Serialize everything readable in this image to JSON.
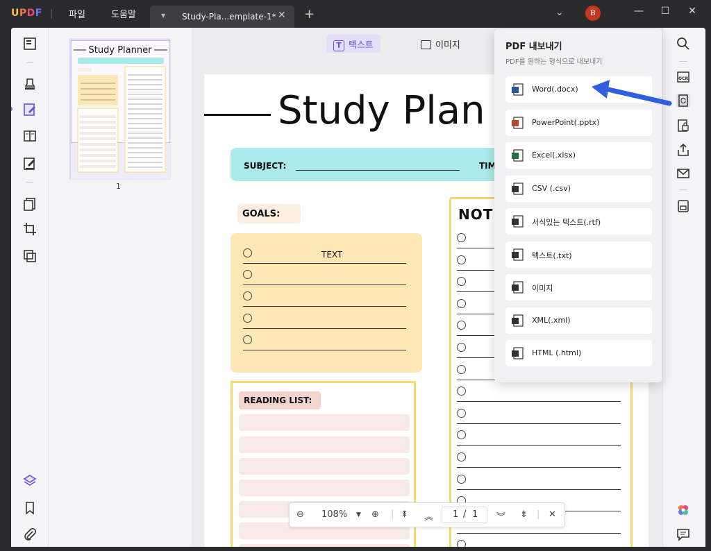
{
  "app": {
    "logo": "UPDF",
    "menus": [
      "파일",
      "도움말"
    ],
    "tab_title": "Study-Pla...emplate-1*",
    "tab_plus": "+",
    "avatar_letter": "B",
    "window_controls": [
      "—",
      "☐",
      "✕"
    ]
  },
  "modes": {
    "text": "텍스트",
    "image": "이미지"
  },
  "thumbnail": {
    "page_number": "1",
    "title": "Study Planner"
  },
  "document": {
    "title": "Study Plan",
    "subject_label": "SUBJECT:",
    "time_label": "TIM",
    "goals_label": "GOALS:",
    "text_label": "TEXT",
    "reading_label": "READING LIST:",
    "notes_label": "NOTE"
  },
  "export_popup": {
    "title": "PDF 내보내기",
    "subtitle": "PDF를 원하는 형식으로 내보내기",
    "items": [
      {
        "label": "Word(.docx)",
        "icon": "word-icon",
        "color": "#2b579a"
      },
      {
        "label": "PowerPoint(.pptx)",
        "icon": "powerpoint-icon",
        "color": "#b7472a"
      },
      {
        "label": "Excel(.xlsx)",
        "icon": "excel-icon",
        "color": "#217346"
      },
      {
        "label": "CSV (.csv)",
        "icon": "csv-icon",
        "color": "#333333"
      },
      {
        "label": "서식있는 텍스트(.rtf)",
        "icon": "rtf-icon",
        "color": "#333333"
      },
      {
        "label": "텍스트(.txt)",
        "icon": "txt-icon",
        "color": "#333333"
      },
      {
        "label": "이미지",
        "icon": "image-icon",
        "color": "#333333"
      },
      {
        "label": "XML(.xml)",
        "icon": "xml-icon",
        "color": "#333333"
      },
      {
        "label": "HTML (.html)",
        "icon": "html-icon",
        "color": "#333333"
      }
    ]
  },
  "zoombar": {
    "zoom": "108%",
    "page_current": "1",
    "page_sep": "/",
    "page_total": "1"
  },
  "colors": {
    "accent": "#6a4fd6",
    "arrow": "#2f5ee0"
  }
}
